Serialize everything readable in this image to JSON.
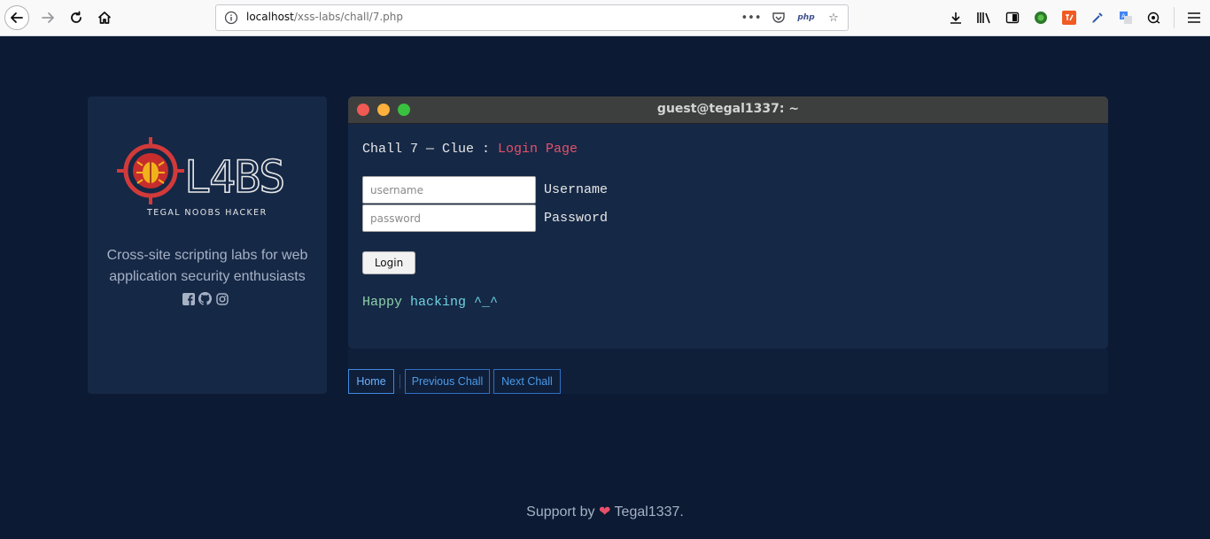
{
  "browser": {
    "url_host": "localhost",
    "url_path": "/xss-labs/chall/7.php",
    "page_action_php": "php"
  },
  "sidebar": {
    "logo_text": "L4BS",
    "logo_subtitle": "TEGAL NOOBS HACKER",
    "tagline": "Cross-site scripting labs for web application security enthusiasts"
  },
  "terminal": {
    "title": "guest@tegal1337: ~",
    "clue_prefix": "Chall 7 — Clue : ",
    "clue_highlight": "Login Page",
    "username_placeholder": "username",
    "password_placeholder": "password",
    "username_label": "Username",
    "password_label": "Password",
    "login_button": "Login",
    "happy_word1": "Happy",
    "happy_word2": " hacking ^_^"
  },
  "nav": {
    "home": "Home",
    "prev": "Previous Chall",
    "next": "Next Chall"
  },
  "footer": {
    "prefix": "Support by ",
    "suffix": " Tegal1337."
  },
  "colors": {
    "background": "#0c1a33",
    "card": "#152846",
    "accent_red": "#e8506a",
    "link_blue": "#4a9ae8"
  }
}
